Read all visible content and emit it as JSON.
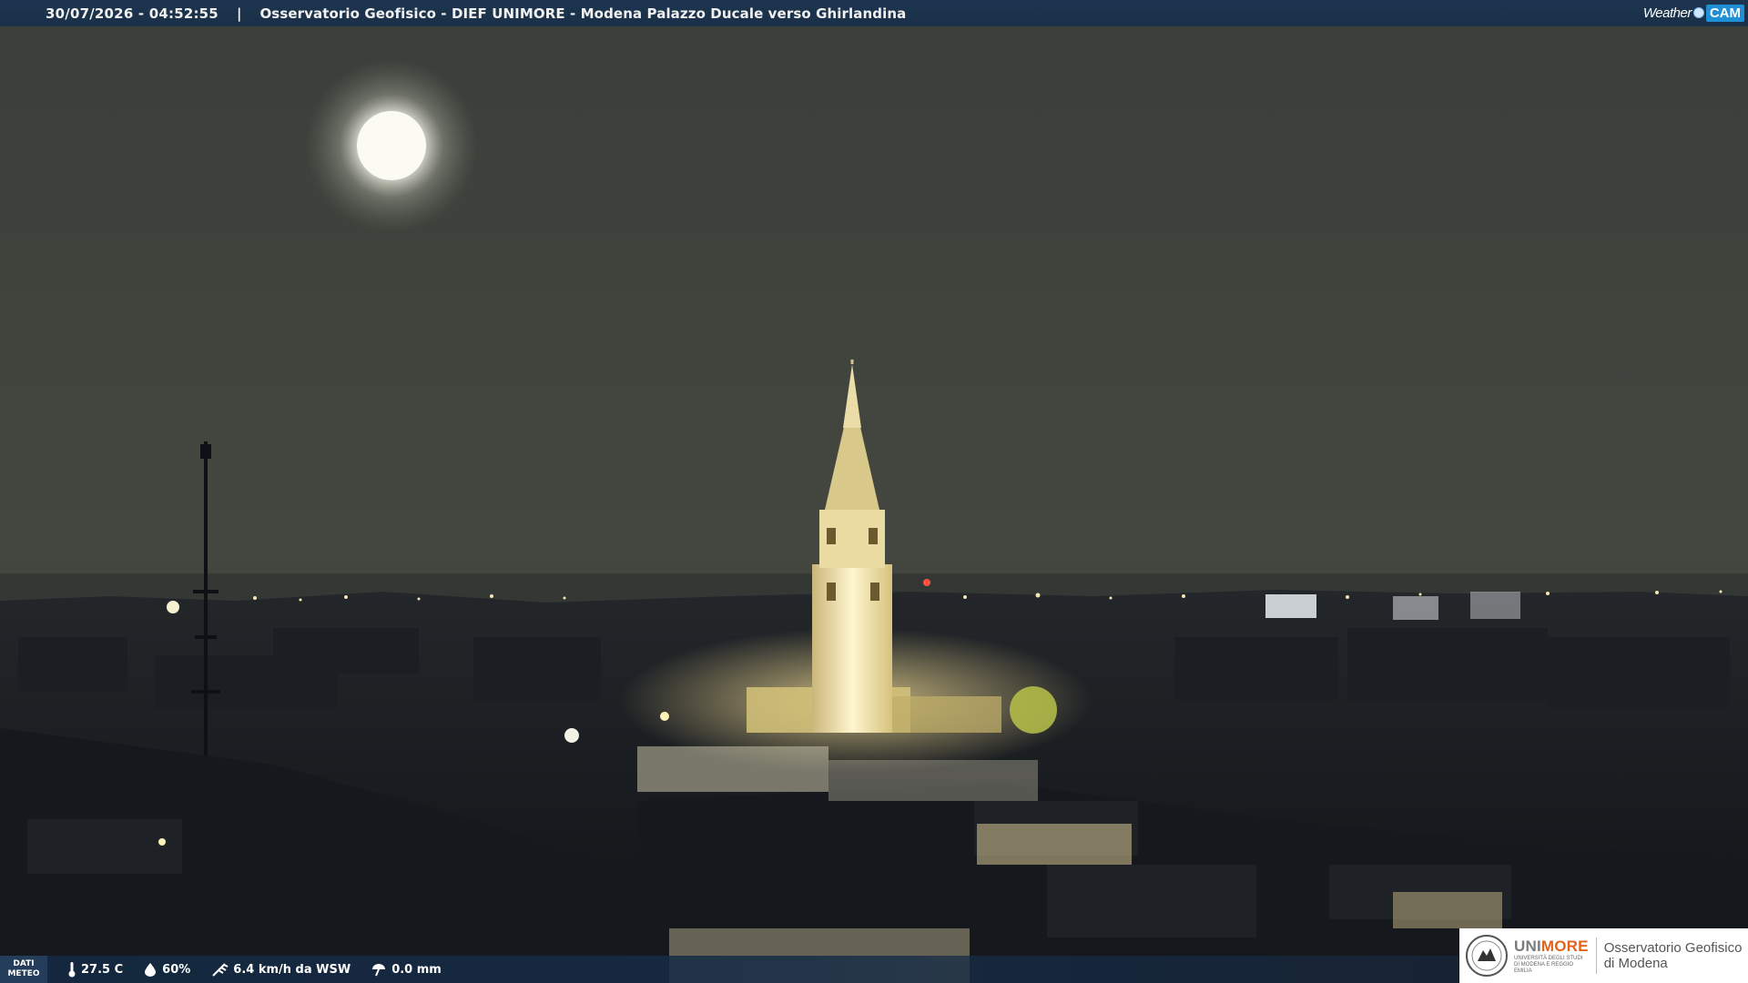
{
  "header": {
    "timestamp": "30/07/2026 - 04:52:55",
    "separator": "|",
    "title": "Osservatorio Geofisico - DIEF UNIMORE - Modena Palazzo Ducale verso Ghirlandina"
  },
  "brand_logo": {
    "weather": "Weather",
    "cam": "CAM"
  },
  "meteo": {
    "label_line1": "DATI",
    "label_line2": "METEO",
    "temperature": "27.5 C",
    "humidity": "60%",
    "wind": "6.4 km/h da WSW",
    "rain": "0.0 mm"
  },
  "institution": {
    "name_prefix": "UNI",
    "name_suffix": "MORE",
    "subtitle": "UNIVERSITÀ DEGLI STUDI DI MODENA E REGGIO EMILIA",
    "observatory_line1": "Osservatorio Geofisico",
    "observatory_line2": "di Modena"
  },
  "colors": {
    "bar_background": "#1d3550",
    "accent_orange": "#e0641b",
    "sky": "#40443d",
    "tower_lit": "#f3e4a6"
  },
  "icons": [
    "thermometer-icon",
    "humidity-drop-icon",
    "wind-icon",
    "rain-gauge-icon",
    "university-seal-icon"
  ]
}
